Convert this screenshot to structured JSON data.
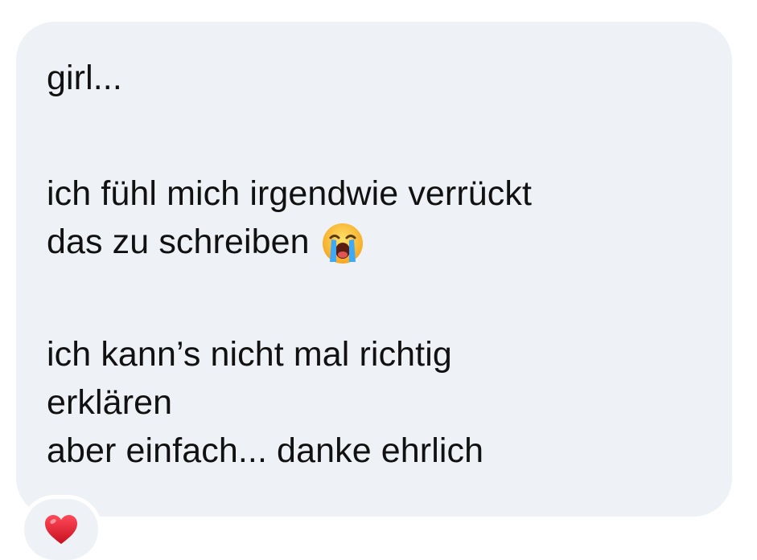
{
  "message": {
    "lines": [
      "girl...",
      "ich fühl mich irgendwie verrückt",
      "das zu schreiben",
      "ich kann’s nicht mal richtig",
      "erklären",
      "aber einfach... danke ehrlich"
    ],
    "emoji": "loudly-crying-face"
  },
  "reaction": {
    "icon": "red-heart",
    "color": "#e0182d"
  },
  "colors": {
    "bubble": "#eef1f5",
    "text": "#111111"
  }
}
